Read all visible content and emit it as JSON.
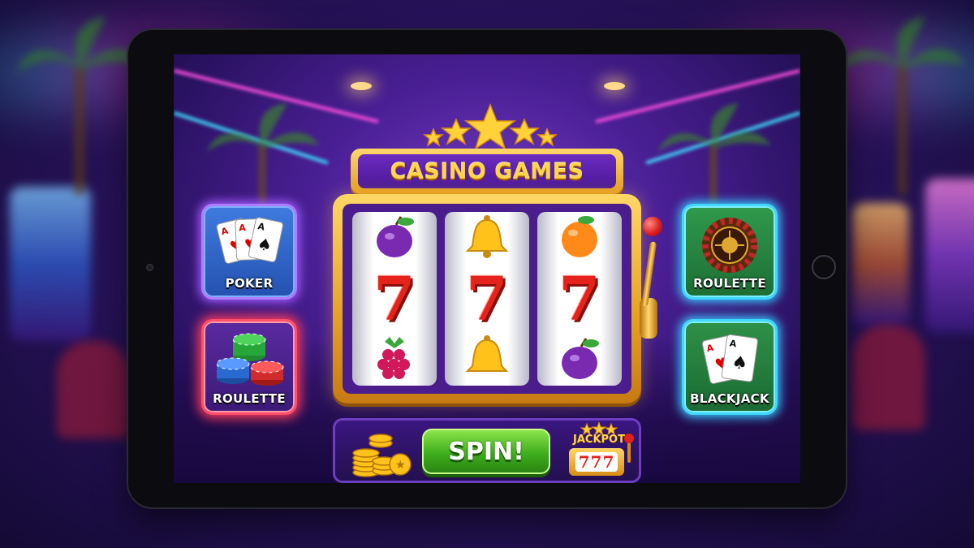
{
  "title": "CASINO GAMES",
  "tiles": {
    "poker": "POKER",
    "chips": "ROULETTE",
    "roulette": "ROULETTE",
    "blackjack": "BLACKJACK"
  },
  "reels": {
    "reel1": [
      "plum-icon",
      "7",
      "raspberry-icon"
    ],
    "reel2": [
      "bell-icon",
      "7",
      "bell-icon"
    ],
    "reel3": [
      "orange-icon",
      "7",
      "plum-icon"
    ],
    "payline": [
      "7",
      "7",
      "7"
    ]
  },
  "spin_label": "SPIN!",
  "jackpot": {
    "label": "JACKPOT",
    "value": "777"
  },
  "colors": {
    "gold": "#ffd54a",
    "spin_green": "#3fae1d",
    "seven_red": "#e5231b",
    "purple": "#4a1796"
  }
}
